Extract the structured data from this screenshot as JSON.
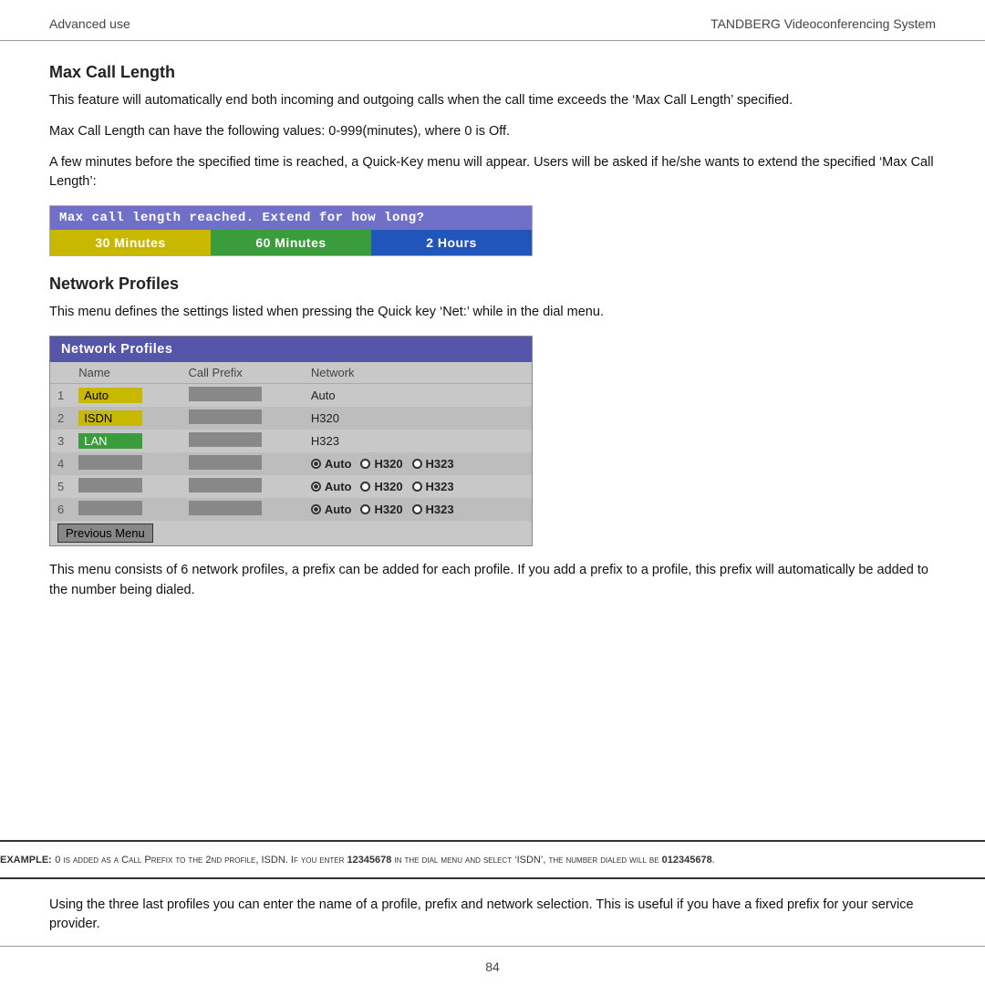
{
  "header": {
    "left": "Advanced use",
    "right": "TANDBERG Videoconferencing System"
  },
  "max_call_length": {
    "title": "Max Call Length",
    "para1": "This feature will automatically end both incoming and outgoing calls when the call time exceeds the ‘Max Call Length’ specified.",
    "para2": "Max Call Length can have the following values: 0-999(minutes), where 0 is Off.",
    "para3": "A few minutes before the specified time is reached, a Quick-Key menu will appear. Users will be asked if he/she wants to extend the specified  ‘Max Call Length’:",
    "quickkey_title": "Max  call  length  reached.  Extend  for  how  long?",
    "btn1": "30 Minutes",
    "btn2": "60 Minutes",
    "btn3": "2 Hours"
  },
  "network_profiles": {
    "title": "Network Profiles",
    "intro": "This menu defines the settings listed when pressing the Quick key ‘Net:’ while in the dial menu.",
    "box_title": "Network  Profiles",
    "col_name": "Name",
    "col_prefix": "Call Prefix",
    "col_network": "Network",
    "rows": [
      {
        "num": "1",
        "name": "Auto",
        "name_style": "yellow",
        "prefix": "",
        "network": "Auto",
        "radio": false
      },
      {
        "num": "2",
        "name": "ISDN",
        "name_style": "yellow",
        "prefix": "",
        "network": "H320",
        "radio": false
      },
      {
        "num": "3",
        "name": "LAN",
        "name_style": "green",
        "prefix": "",
        "network": "H323",
        "radio": false
      },
      {
        "num": "4",
        "name": "",
        "name_style": "gray",
        "prefix": "",
        "network": "",
        "radio": true
      },
      {
        "num": "5",
        "name": "",
        "name_style": "gray",
        "prefix": "",
        "network": "",
        "radio": true
      },
      {
        "num": "6",
        "name": "",
        "name_style": "gray",
        "prefix": "",
        "network": "",
        "radio": true
      }
    ],
    "prev_menu": "Previous  Menu",
    "radio_options": [
      "Auto",
      "H320",
      "H323"
    ],
    "body1": "This menu consists of 6 network profiles, a prefix can be added for each profile. If you add a prefix to a profile, this prefix will automatically be added to the number being dialed.",
    "example_label": "Example:",
    "example_text": "0 is added as a Call Prefix to the 2nd profile, ISDN. If you enter 12345678 in the dial menu and select ‘ISDN’, the number dialed will be ",
    "example_num": "012345678",
    "example_end": ".",
    "body2": "Using the three last profiles you can enter the name of a profile, prefix and network selection. This is useful if you have a fixed prefix for your service provider."
  },
  "footer": {
    "page_num": "84"
  }
}
